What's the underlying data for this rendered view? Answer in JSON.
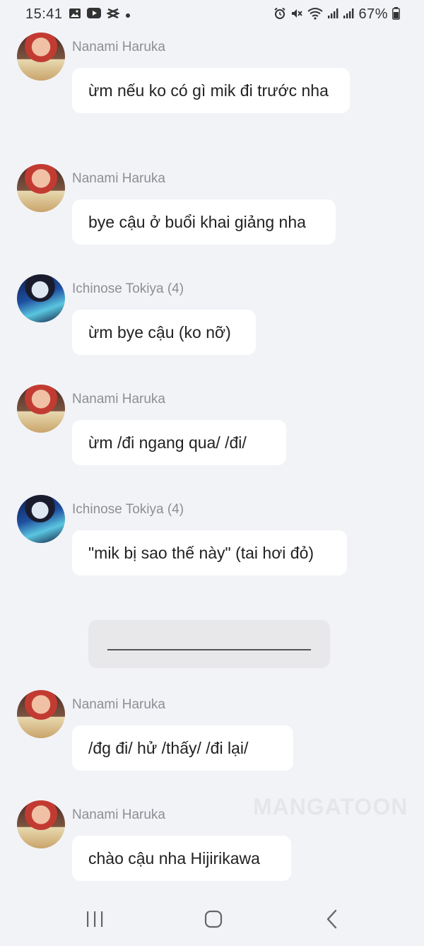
{
  "status_bar": {
    "time": "15:41",
    "battery": "67%",
    "left_icons": [
      "gallery-icon",
      "youtube-icon",
      "capcut-icon",
      "dot-icon"
    ],
    "right_icons": [
      "alarm-icon",
      "mute-icon",
      "wifi-icon",
      "signal-icon",
      "signal-icon",
      "battery-icon"
    ]
  },
  "messages": [
    {
      "sender": "Nanami Haruka",
      "avatar": "red",
      "text": "ừm nếu ko có gì mik đi trước nha"
    },
    {
      "sender": "Nanami Haruka",
      "avatar": "red",
      "text": "bye cậu ở buổi khai giảng nha"
    },
    {
      "sender": "Ichinose Tokiya (4)",
      "avatar": "blue",
      "text": "ừm bye cậu (ko nỡ)"
    },
    {
      "sender": "Nanami Haruka",
      "avatar": "red",
      "text": "ừm /đi ngang qua/ /đi/"
    },
    {
      "sender": "Ichinose Tokiya (4)",
      "avatar": "blue",
      "text": "\"mik bị sao thế này\" (tai hơi đỏ)"
    },
    {
      "sender": "Nanami Haruka",
      "avatar": "red",
      "text": "/đg đi/ hử /thấy/ /đi lại/"
    },
    {
      "sender": "Nanami Haruka",
      "avatar": "red",
      "text": "chào cậu nha Hijirikawa"
    }
  ],
  "watermark": "MANGATOON"
}
